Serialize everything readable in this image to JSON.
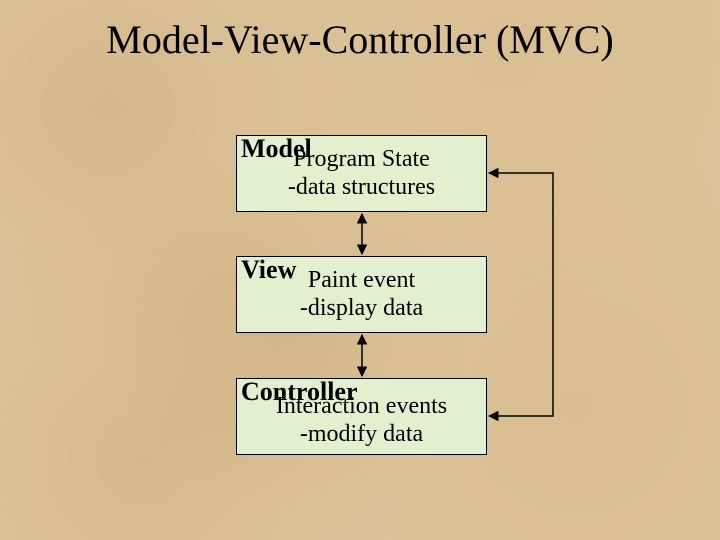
{
  "title": "Model-View-Controller (MVC)",
  "boxes": {
    "model": {
      "label": "Model",
      "line1": "Program State",
      "line2": "-data structures"
    },
    "view": {
      "label": "View",
      "line1": "Paint event",
      "line2": "-display data"
    },
    "controller": {
      "label": "Controller",
      "line1": "Interaction events",
      "line2": "-modify data"
    }
  }
}
